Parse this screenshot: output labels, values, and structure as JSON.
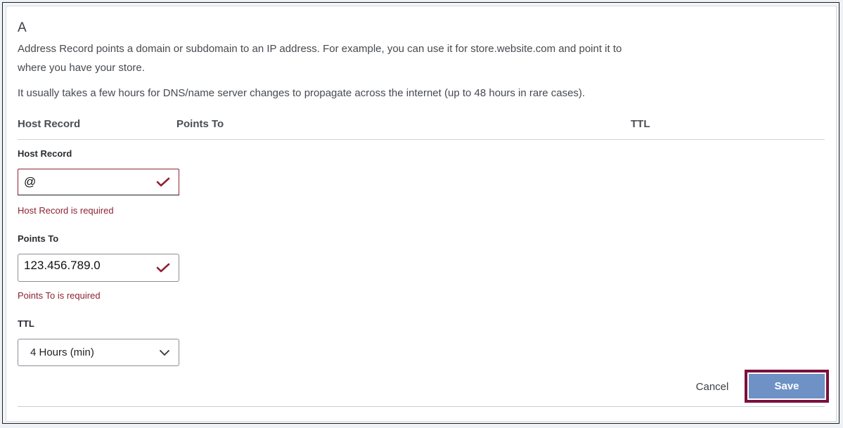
{
  "record": {
    "type": "A",
    "description": "Address Record points a domain or subdomain to an IP address. For example, you can use it for store.website.com and point it to where you have your store.",
    "propagation_note": "It usually takes a few hours for DNS/name server changes to propagate across the internet (up to 48 hours in rare cases)."
  },
  "table": {
    "columns": [
      "Host Record",
      "Points To",
      "TTL"
    ]
  },
  "form": {
    "host_record": {
      "label": "Host Record",
      "value": "@",
      "error": "Host Record is required",
      "status_icon": "check-icon"
    },
    "points_to": {
      "label": "Points To",
      "value": "123.456.789.0",
      "error": "Points To is required",
      "status_icon": "check-icon"
    },
    "ttl": {
      "label": "TTL",
      "selected": "4 Hours (min)",
      "icon": "chevron-down-icon"
    }
  },
  "actions": {
    "cancel_label": "Cancel",
    "save_label": "Save"
  },
  "colors": {
    "error": "#8d2233",
    "save_button": "#6e91c6",
    "focus_outline": "#7b0f3b"
  }
}
